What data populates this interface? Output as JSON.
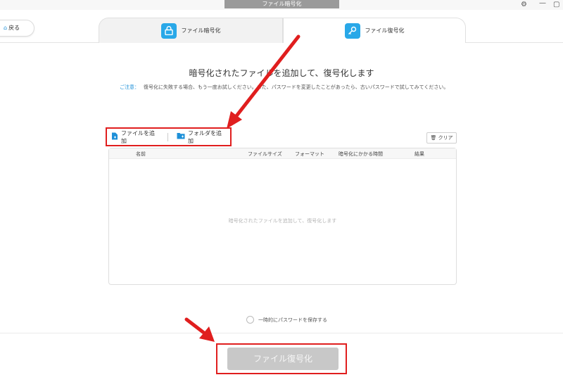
{
  "window": {
    "title": "ファイル暗号化",
    "gear_glyph": "⚙",
    "min_glyph": "—",
    "max_glyph": "▢"
  },
  "back_button": {
    "label": "戻る"
  },
  "tabs": [
    {
      "label": "ファイル暗号化",
      "icon": "lock-icon"
    },
    {
      "label": "ファイル復号化",
      "icon": "key-icon"
    }
  ],
  "main": {
    "title": "暗号化されたファイルを追加して、復号化します",
    "notice_label": "ご注意：",
    "notice_text": "復号化に失敗する場合、もう一度お試しください。また、パスワードを変更したことがあったら、古いパスワードで試してみてください。"
  },
  "toolbar": {
    "add_file": "ファイルを追加",
    "add_folder": "フォルダを追加",
    "clear": "クリア"
  },
  "table": {
    "columns": [
      "名前",
      "ファイルサイズ",
      "フォーマット",
      "暗号化にかかる時間",
      "結果"
    ],
    "empty_message": "暗号化されたファイルを追加して、復号化します"
  },
  "options": {
    "save_password": "一時的にパスワードを保存する"
  },
  "action": {
    "decrypt_label": "ファイル復号化"
  },
  "colors": {
    "accent": "#1e90d8",
    "annotation": "#e01e1e",
    "disabled_button": "#c8c8c8"
  }
}
